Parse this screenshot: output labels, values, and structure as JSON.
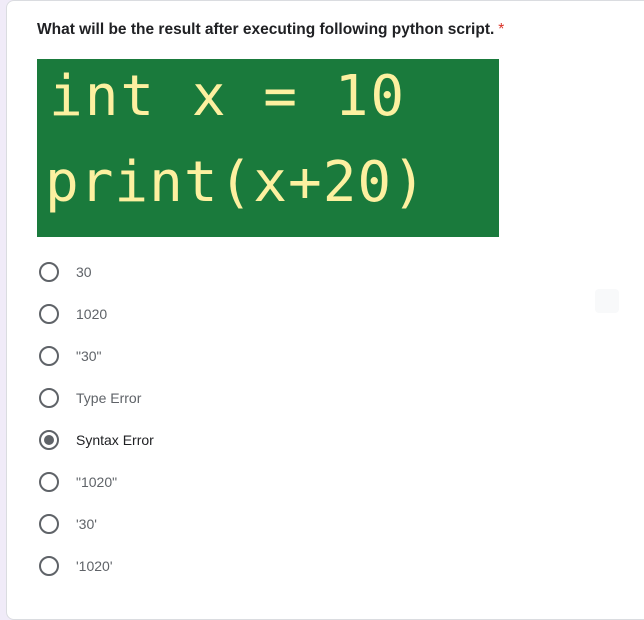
{
  "question": {
    "text": "What will be the result after executing following python script.",
    "required_mark": "*"
  },
  "code_image": {
    "line1": "int x = 10",
    "line2": "print(x+20)",
    "background": "#1a7a3c",
    "text_color": "#fdf0a0"
  },
  "options": [
    {
      "label": "30",
      "selected": false
    },
    {
      "label": "1020",
      "selected": false
    },
    {
      "label": "\"30\"",
      "selected": false
    },
    {
      "label": "Type Error",
      "selected": false
    },
    {
      "label": "Syntax Error",
      "selected": true
    },
    {
      "label": "\"1020\"",
      "selected": false
    },
    {
      "label": "'30'",
      "selected": false
    },
    {
      "label": "'1020'",
      "selected": false
    }
  ],
  "colors": {
    "required": "#d93025",
    "radio": "#5f6368",
    "text_primary": "#202124",
    "text_secondary": "#5f6368"
  }
}
